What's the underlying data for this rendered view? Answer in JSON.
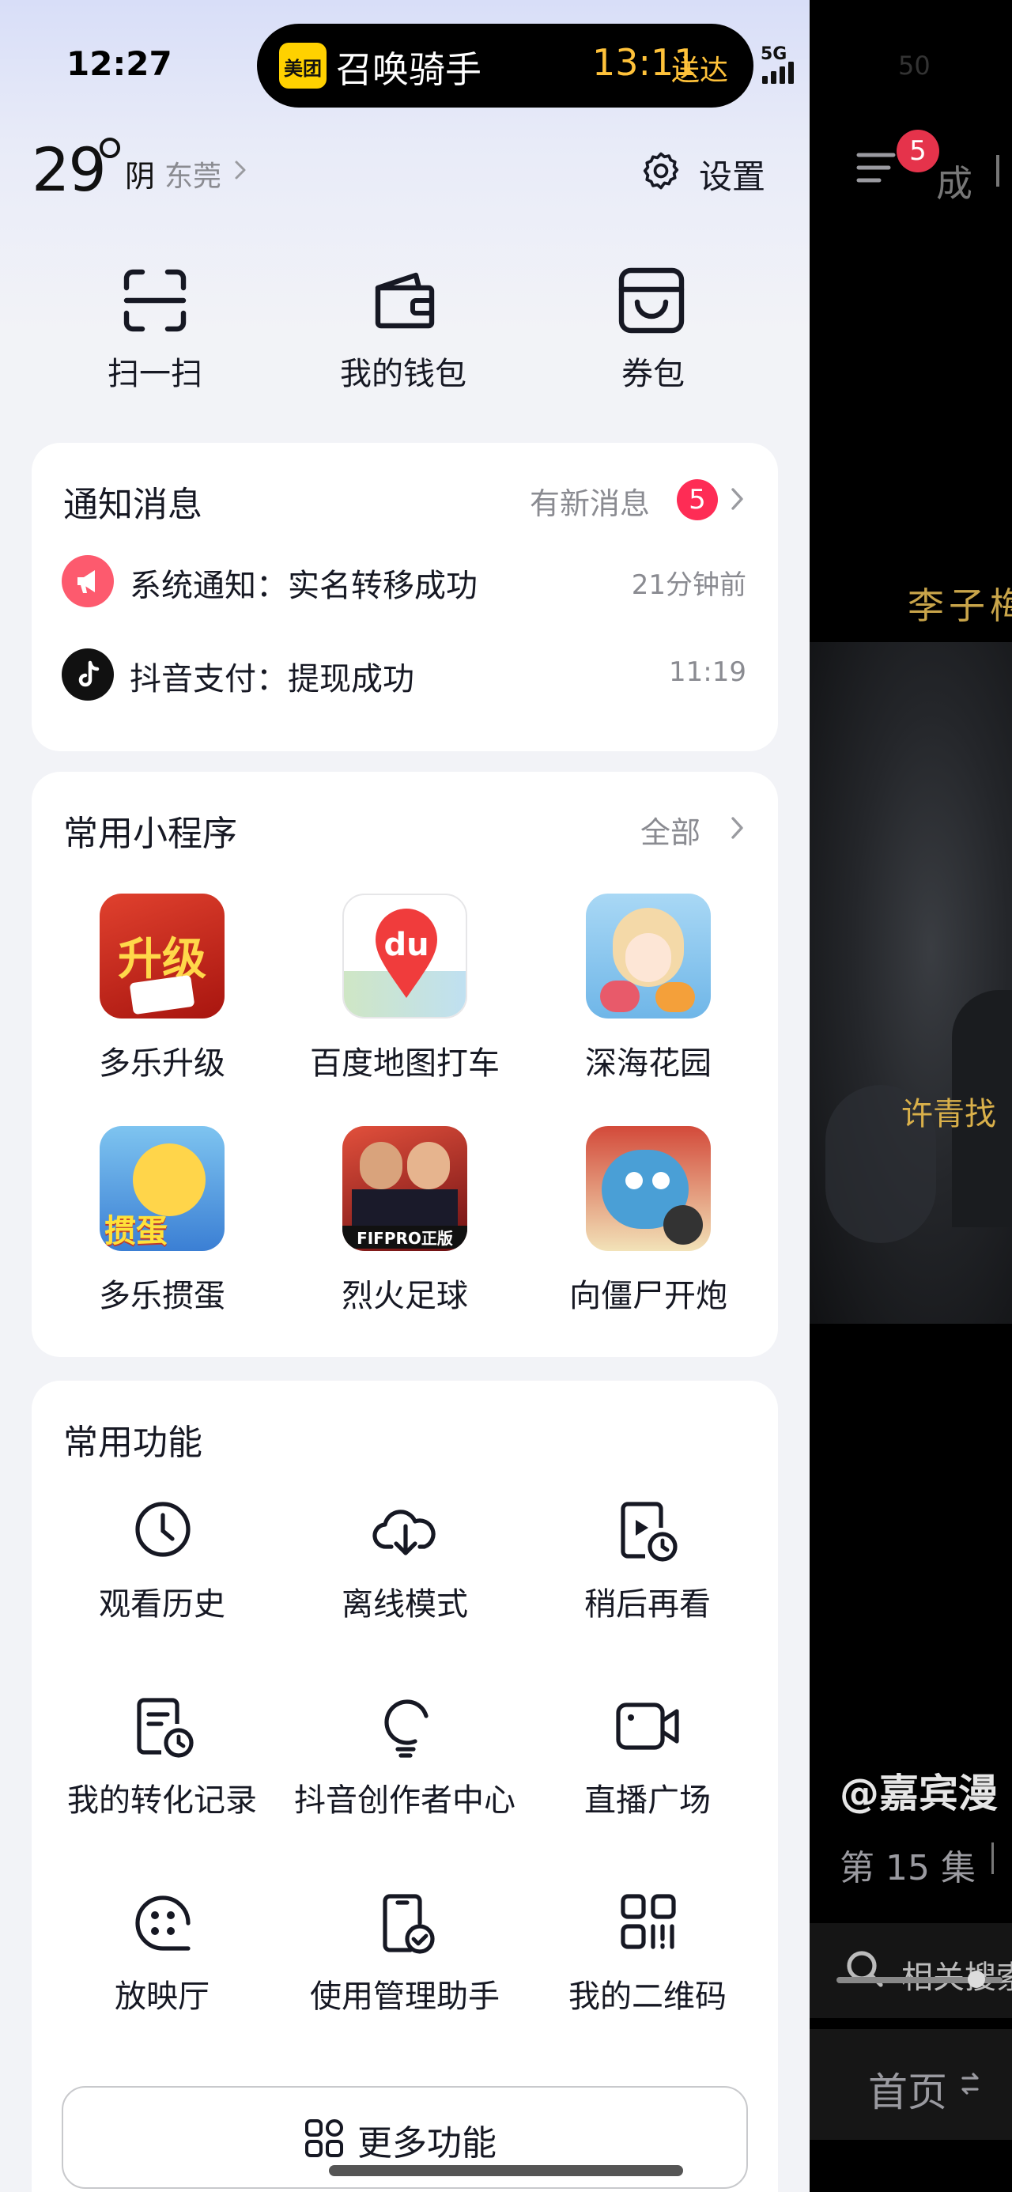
{
  "status_bar": {
    "time": "12:27",
    "island": {
      "app_badge": "美团",
      "title": "召唤骑手",
      "eta_time": "13:11",
      "eta_label": "送达"
    },
    "network": "5G",
    "battery": "50"
  },
  "weather": {
    "temp": "29",
    "condition": "阴",
    "city": "东莞"
  },
  "settings_label": "设置",
  "quick_actions": [
    {
      "label": "扫一扫",
      "icon": "scan-icon"
    },
    {
      "label": "我的钱包",
      "icon": "wallet-icon"
    },
    {
      "label": "券包",
      "icon": "coupon-icon"
    }
  ],
  "notifications": {
    "title": "通知消息",
    "new_label": "有新消息",
    "badge": "5",
    "items": [
      {
        "text": "系统通知：实名转移成功",
        "time": "21分钟前",
        "icon": "megaphone-icon"
      },
      {
        "text": "抖音支付：提现成功",
        "time": "11:19",
        "icon": "douyin-icon"
      }
    ]
  },
  "mini_programs": {
    "title": "常用小程序",
    "all_label": "全部",
    "items": [
      {
        "label": "多乐升级",
        "icon_text": "升级",
        "color": "#c8281f"
      },
      {
        "label": "百度地图打车",
        "icon_text": "du",
        "color": "#f03c3c"
      },
      {
        "label": "深海花园",
        "icon_text": "",
        "color": "#6fb6e8"
      },
      {
        "label": "多乐掼蛋",
        "icon_text": "掼蛋",
        "color": "#3b7fd4"
      },
      {
        "label": "烈火足球",
        "icon_text": "FIFPRO正版",
        "color": "#b5262a"
      },
      {
        "label": "向僵尸开炮",
        "icon_text": "",
        "color": "#4a9fd6"
      }
    ]
  },
  "functions": {
    "title": "常用功能",
    "items": [
      {
        "label": "观看历史",
        "icon": "clock-icon"
      },
      {
        "label": "离线模式",
        "icon": "cloud-download-icon"
      },
      {
        "label": "稍后再看",
        "icon": "watch-later-icon"
      },
      {
        "label": "我的转化记录",
        "icon": "record-icon"
      },
      {
        "label": "抖音创作者中心",
        "icon": "bulb-icon"
      },
      {
        "label": "直播广场",
        "icon": "camera-icon"
      },
      {
        "label": "放映厅",
        "icon": "film-reel-icon"
      },
      {
        "label": "使用管理助手",
        "icon": "phone-check-icon"
      },
      {
        "label": "我的二维码",
        "icon": "qr-code-icon"
      }
    ],
    "more_label": "更多功能"
  },
  "right_panel": {
    "menu_badge": "5",
    "top_text": "成",
    "subtitle_1": "李子梅",
    "subtitle_2": "许青找",
    "author": "@嘉宾漫",
    "episode": "第 15 集",
    "search": "相关搜索",
    "nav_label": "首页"
  }
}
